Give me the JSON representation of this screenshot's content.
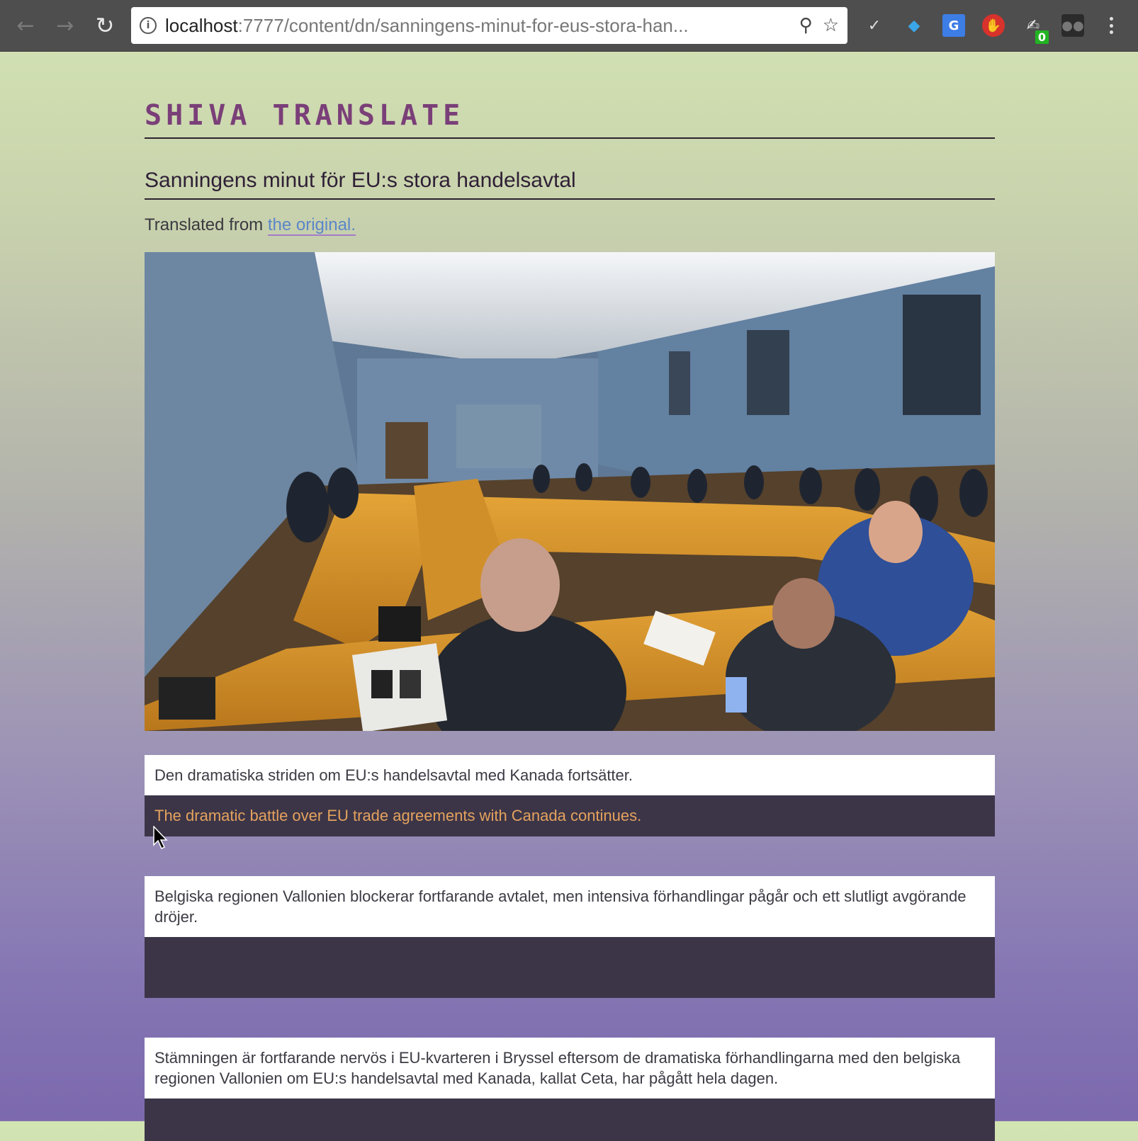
{
  "browser": {
    "url_host": "localhost",
    "url_rest": ":7777/content/dn/sanningens-minut-for-eus-stora-han...",
    "extension_badge": "0"
  },
  "page": {
    "brand": "Shiva Translate",
    "title": "Sanningens minut för EU:s stora handelsavtal",
    "translated_prefix": "Translated from ",
    "original_link": "the original."
  },
  "paragraphs": [
    {
      "source": "Den dramatiska striden om EU:s handelsavtal med Kanada fortsätter.",
      "translation": "The dramatic battle over EU trade agreements with Canada continues."
    },
    {
      "source": "Belgiska regionen Vallonien blockerar fortfarande avtalet, men intensiva förhandlingar pågår och ett slutligt avgörande dröjer.",
      "translation": ""
    },
    {
      "source": "Stämningen är fortfarande nervös i EU-kvarteren i Bryssel eftersom de dramatiska förhandlingarna med den belgiska regionen Vallonien om EU:s handelsavtal med Kanada, kallat Ceta, har pågått hela dagen.",
      "translation": ""
    }
  ],
  "colors": {
    "brand": "#7a3f78",
    "translation_bg": "#3c3548",
    "translation_text": "#e4a25d",
    "link": "#5b86c9"
  }
}
